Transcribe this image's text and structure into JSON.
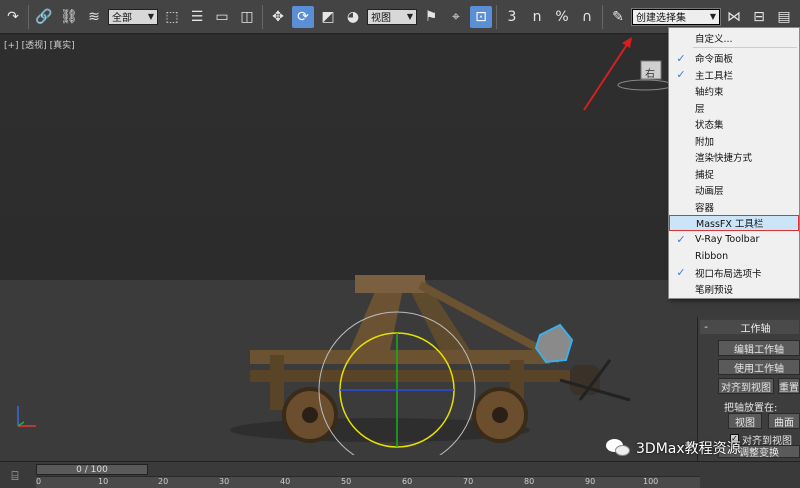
{
  "toolbar": {
    "filter_dropdown": "全部",
    "ref_coord_dropdown": "视图",
    "selection_set_dropdown": "创建选择集",
    "snap_label": "3",
    "angle_snap_label": "n",
    "percent_snap_label": "%",
    "icons": [
      "undo-icon",
      "link-icon",
      "unlink-icon",
      "bind-spacewarp-icon",
      "select-object-icon",
      "select-by-name-icon",
      "rect-region-icon",
      "window-crossing-icon",
      "move-icon",
      "rotate-icon",
      "scale-icon",
      "pivot-icon",
      "select-manipulate-icon",
      "keyboard-shortcut-icon",
      "snap-icon",
      "angle-snap-icon",
      "percent-snap-icon",
      "spinner-snap-icon",
      "edit-named-sets-icon",
      "mirror-icon",
      "align-icon",
      "layer-icon",
      "scene-explorer-icon"
    ]
  },
  "viewport": {
    "label_parts": [
      "[+]",
      "[透视]",
      "[真实]"
    ],
    "viewcube_label": "右"
  },
  "context_menu": {
    "header": "自定义...",
    "items": [
      {
        "label": "命令面板",
        "checked": true
      },
      {
        "label": "主工具栏",
        "checked": true
      },
      {
        "label": "轴约束",
        "checked": false
      },
      {
        "label": "层",
        "checked": false
      },
      {
        "label": "状态集",
        "checked": false
      },
      {
        "label": "附加",
        "checked": false
      },
      {
        "label": "渲染快捷方式",
        "checked": false
      },
      {
        "label": "捕捉",
        "checked": false
      },
      {
        "label": "动画层",
        "checked": false
      },
      {
        "label": "容器",
        "checked": false
      },
      {
        "label": "MassFX 工具栏",
        "checked": false,
        "highlighted": true
      },
      {
        "label": "V-Ray Toolbar",
        "checked": true
      },
      {
        "label": "Ribbon",
        "checked": false
      },
      {
        "label": "视口布局选项卡",
        "checked": true
      },
      {
        "label": "笔刷预设",
        "checked": false
      }
    ]
  },
  "command_panel": {
    "rollout_title": "工作轴",
    "rollout_toggle": "-",
    "edit_pivot": "编辑工作轴",
    "use_pivot": "使用工作轴",
    "align_to_view": "对齐到视图",
    "reset": "重置",
    "place_pivot_label": "把轴放置在:",
    "view_btn": "视图",
    "surface_btn": "曲面",
    "align_to_view_check": "对齐到视图",
    "adjust_transform": "调整变换"
  },
  "timeline": {
    "slider": "0 / 100",
    "ticks": [
      "0",
      "10",
      "20",
      "30",
      "40",
      "50",
      "60",
      "70",
      "80",
      "90",
      "100"
    ]
  },
  "watermark": {
    "text": "3DMax教程资源"
  },
  "colors": {
    "accent": "#5a8fd6",
    "highlight_border": "#d33333",
    "annotation_arrow": "#d62020",
    "check": "#3b7fd0"
  }
}
